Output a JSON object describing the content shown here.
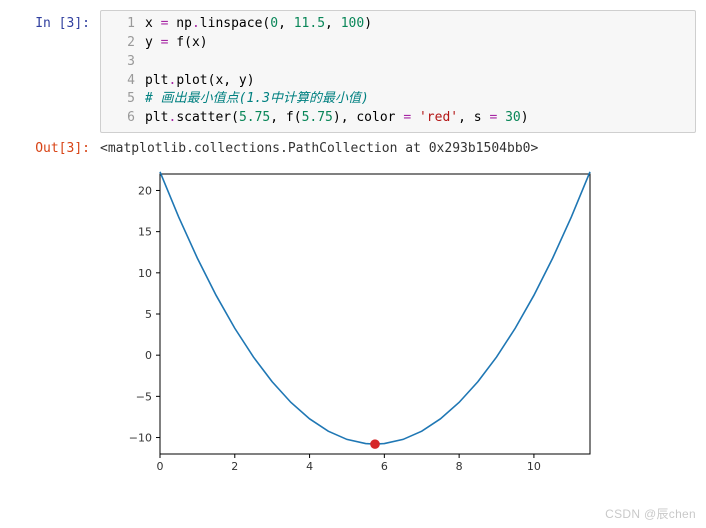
{
  "prompts": {
    "in": "In [3]:",
    "out": "Out[3]:"
  },
  "code_lines": [
    {
      "n": "1",
      "html": "x <span class=\"tk-op\">=</span> np<span class=\"tk-op\">.</span>linspace(<span class=\"tk-num\">0</span>, <span class=\"tk-num\">11.5</span>, <span class=\"tk-num\">100</span>)"
    },
    {
      "n": "2",
      "html": "y <span class=\"tk-op\">=</span> f(x)"
    },
    {
      "n": "3",
      "html": ""
    },
    {
      "n": "4",
      "html": "plt<span class=\"tk-op\">.</span>plot(x, y)"
    },
    {
      "n": "5",
      "html": "<span class=\"tk-com\"># 画出最小值点(1.3中计算的最小值)</span>"
    },
    {
      "n": "6",
      "html": "plt<span class=\"tk-op\">.</span>scatter(<span class=\"tk-num\">5.75</span>, f(<span class=\"tk-num\">5.75</span>), color <span class=\"tk-op\">=</span> <span class=\"tk-str\">'red'</span>, s <span class=\"tk-op\">=</span> <span class=\"tk-num\">30</span>)"
    }
  ],
  "output_repr": "<matplotlib.collections.PathCollection at 0x293b1504bb0>",
  "chart_data": {
    "type": "line",
    "title": "",
    "xlabel": "",
    "ylabel": "",
    "xlim": [
      0,
      11.5
    ],
    "ylim": [
      -12,
      22
    ],
    "xticks": [
      0,
      2,
      4,
      6,
      8,
      10
    ],
    "yticks": [
      -10,
      -5,
      0,
      5,
      10,
      15,
      20
    ],
    "series": [
      {
        "name": "f(x)",
        "color": "#1f77b4",
        "x": [
          0,
          0.5,
          1,
          1.5,
          2,
          2.5,
          3,
          3.5,
          4,
          4.5,
          5,
          5.5,
          5.75,
          6,
          6.5,
          7,
          7.5,
          8,
          8.5,
          9,
          9.5,
          10,
          10.5,
          11,
          11.5
        ],
        "y": [
          22.27,
          16.77,
          11.77,
          7.27,
          3.27,
          -0.23,
          -3.23,
          -5.73,
          -7.73,
          -9.23,
          -10.23,
          -10.73,
          -10.8,
          -10.73,
          -10.23,
          -9.23,
          -7.73,
          -5.73,
          -3.23,
          -0.23,
          3.27,
          7.27,
          11.77,
          16.77,
          22.27
        ]
      }
    ],
    "scatter": {
      "x": 5.75,
      "y": -10.8,
      "color": "#d62728",
      "size": 30
    }
  },
  "watermark": "CSDN @辰chen"
}
